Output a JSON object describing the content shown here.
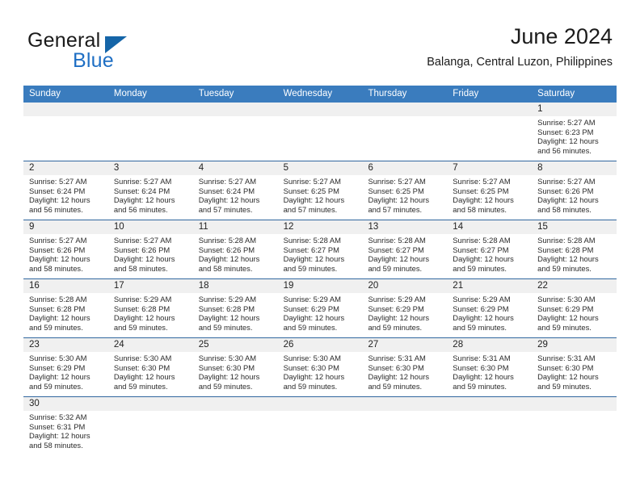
{
  "brand": {
    "word1": "General",
    "word2": "Blue",
    "accent_color": "#1f6fc4"
  },
  "header": {
    "month_title": "June 2024",
    "location": "Balanga, Central Luzon, Philippines"
  },
  "calendar": {
    "header_bg": "#3a7cbe",
    "weekdays": [
      "Sunday",
      "Monday",
      "Tuesday",
      "Wednesday",
      "Thursday",
      "Friday",
      "Saturday"
    ],
    "weeks": [
      [
        {
          "empty": true
        },
        {
          "empty": true
        },
        {
          "empty": true
        },
        {
          "empty": true
        },
        {
          "empty": true
        },
        {
          "empty": true
        },
        {
          "day": "1",
          "sunrise": "Sunrise: 5:27 AM",
          "sunset": "Sunset: 6:23 PM",
          "daylight": "Daylight: 12 hours and 56 minutes."
        }
      ],
      [
        {
          "day": "2",
          "sunrise": "Sunrise: 5:27 AM",
          "sunset": "Sunset: 6:24 PM",
          "daylight": "Daylight: 12 hours and 56 minutes."
        },
        {
          "day": "3",
          "sunrise": "Sunrise: 5:27 AM",
          "sunset": "Sunset: 6:24 PM",
          "daylight": "Daylight: 12 hours and 56 minutes."
        },
        {
          "day": "4",
          "sunrise": "Sunrise: 5:27 AM",
          "sunset": "Sunset: 6:24 PM",
          "daylight": "Daylight: 12 hours and 57 minutes."
        },
        {
          "day": "5",
          "sunrise": "Sunrise: 5:27 AM",
          "sunset": "Sunset: 6:25 PM",
          "daylight": "Daylight: 12 hours and 57 minutes."
        },
        {
          "day": "6",
          "sunrise": "Sunrise: 5:27 AM",
          "sunset": "Sunset: 6:25 PM",
          "daylight": "Daylight: 12 hours and 57 minutes."
        },
        {
          "day": "7",
          "sunrise": "Sunrise: 5:27 AM",
          "sunset": "Sunset: 6:25 PM",
          "daylight": "Daylight: 12 hours and 58 minutes."
        },
        {
          "day": "8",
          "sunrise": "Sunrise: 5:27 AM",
          "sunset": "Sunset: 6:26 PM",
          "daylight": "Daylight: 12 hours and 58 minutes."
        }
      ],
      [
        {
          "day": "9",
          "sunrise": "Sunrise: 5:27 AM",
          "sunset": "Sunset: 6:26 PM",
          "daylight": "Daylight: 12 hours and 58 minutes."
        },
        {
          "day": "10",
          "sunrise": "Sunrise: 5:27 AM",
          "sunset": "Sunset: 6:26 PM",
          "daylight": "Daylight: 12 hours and 58 minutes."
        },
        {
          "day": "11",
          "sunrise": "Sunrise: 5:28 AM",
          "sunset": "Sunset: 6:26 PM",
          "daylight": "Daylight: 12 hours and 58 minutes."
        },
        {
          "day": "12",
          "sunrise": "Sunrise: 5:28 AM",
          "sunset": "Sunset: 6:27 PM",
          "daylight": "Daylight: 12 hours and 59 minutes."
        },
        {
          "day": "13",
          "sunrise": "Sunrise: 5:28 AM",
          "sunset": "Sunset: 6:27 PM",
          "daylight": "Daylight: 12 hours and 59 minutes."
        },
        {
          "day": "14",
          "sunrise": "Sunrise: 5:28 AM",
          "sunset": "Sunset: 6:27 PM",
          "daylight": "Daylight: 12 hours and 59 minutes."
        },
        {
          "day": "15",
          "sunrise": "Sunrise: 5:28 AM",
          "sunset": "Sunset: 6:28 PM",
          "daylight": "Daylight: 12 hours and 59 minutes."
        }
      ],
      [
        {
          "day": "16",
          "sunrise": "Sunrise: 5:28 AM",
          "sunset": "Sunset: 6:28 PM",
          "daylight": "Daylight: 12 hours and 59 minutes."
        },
        {
          "day": "17",
          "sunrise": "Sunrise: 5:29 AM",
          "sunset": "Sunset: 6:28 PM",
          "daylight": "Daylight: 12 hours and 59 minutes."
        },
        {
          "day": "18",
          "sunrise": "Sunrise: 5:29 AM",
          "sunset": "Sunset: 6:28 PM",
          "daylight": "Daylight: 12 hours and 59 minutes."
        },
        {
          "day": "19",
          "sunrise": "Sunrise: 5:29 AM",
          "sunset": "Sunset: 6:29 PM",
          "daylight": "Daylight: 12 hours and 59 minutes."
        },
        {
          "day": "20",
          "sunrise": "Sunrise: 5:29 AM",
          "sunset": "Sunset: 6:29 PM",
          "daylight": "Daylight: 12 hours and 59 minutes."
        },
        {
          "day": "21",
          "sunrise": "Sunrise: 5:29 AM",
          "sunset": "Sunset: 6:29 PM",
          "daylight": "Daylight: 12 hours and 59 minutes."
        },
        {
          "day": "22",
          "sunrise": "Sunrise: 5:30 AM",
          "sunset": "Sunset: 6:29 PM",
          "daylight": "Daylight: 12 hours and 59 minutes."
        }
      ],
      [
        {
          "day": "23",
          "sunrise": "Sunrise: 5:30 AM",
          "sunset": "Sunset: 6:29 PM",
          "daylight": "Daylight: 12 hours and 59 minutes."
        },
        {
          "day": "24",
          "sunrise": "Sunrise: 5:30 AM",
          "sunset": "Sunset: 6:30 PM",
          "daylight": "Daylight: 12 hours and 59 minutes."
        },
        {
          "day": "25",
          "sunrise": "Sunrise: 5:30 AM",
          "sunset": "Sunset: 6:30 PM",
          "daylight": "Daylight: 12 hours and 59 minutes."
        },
        {
          "day": "26",
          "sunrise": "Sunrise: 5:30 AM",
          "sunset": "Sunset: 6:30 PM",
          "daylight": "Daylight: 12 hours and 59 minutes."
        },
        {
          "day": "27",
          "sunrise": "Sunrise: 5:31 AM",
          "sunset": "Sunset: 6:30 PM",
          "daylight": "Daylight: 12 hours and 59 minutes."
        },
        {
          "day": "28",
          "sunrise": "Sunrise: 5:31 AM",
          "sunset": "Sunset: 6:30 PM",
          "daylight": "Daylight: 12 hours and 59 minutes."
        },
        {
          "day": "29",
          "sunrise": "Sunrise: 5:31 AM",
          "sunset": "Sunset: 6:30 PM",
          "daylight": "Daylight: 12 hours and 59 minutes."
        }
      ],
      [
        {
          "day": "30",
          "sunrise": "Sunrise: 5:32 AM",
          "sunset": "Sunset: 6:31 PM",
          "daylight": "Daylight: 12 hours and 58 minutes."
        },
        {
          "empty": true
        },
        {
          "empty": true
        },
        {
          "empty": true
        },
        {
          "empty": true
        },
        {
          "empty": true
        },
        {
          "empty": true
        }
      ]
    ]
  }
}
